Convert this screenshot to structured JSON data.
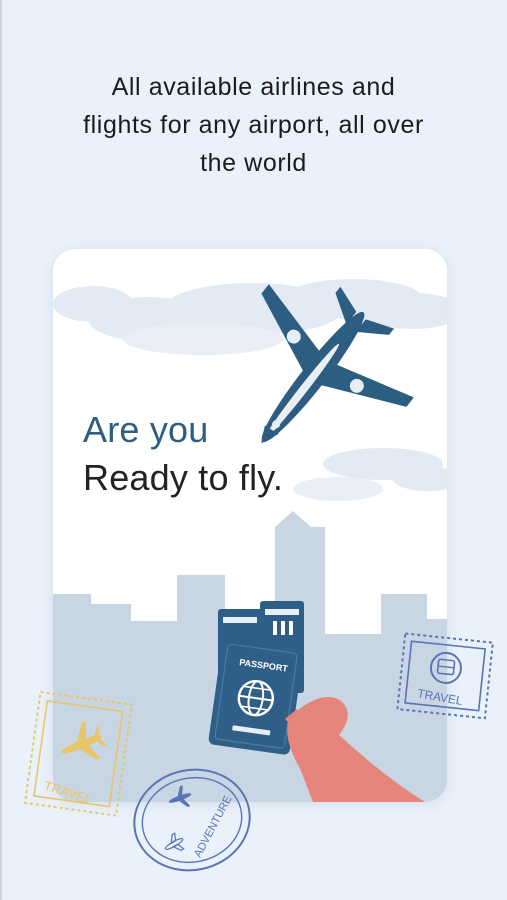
{
  "onboarding": {
    "headline_lines": [
      "All available airlines and",
      "flights for any airport, all over",
      "the world"
    ]
  },
  "card": {
    "tagline_line1": "Are you",
    "tagline_line2": "Ready to fly.",
    "passport_label": "PASSPORT"
  },
  "stamps": {
    "gold_travel": "TRAVEL",
    "blue_travel": "TRAVEL",
    "adventure": "ADVENTURE"
  },
  "colors": {
    "background": "#e9f1fb",
    "accent_blue": "#2d5d80",
    "passport_blue": "#2f5f86",
    "hand": "#e5857c",
    "skyline": "#c8d6e3",
    "stamp_gold": "#e8c46a",
    "stamp_blue": "#5a74b5"
  }
}
